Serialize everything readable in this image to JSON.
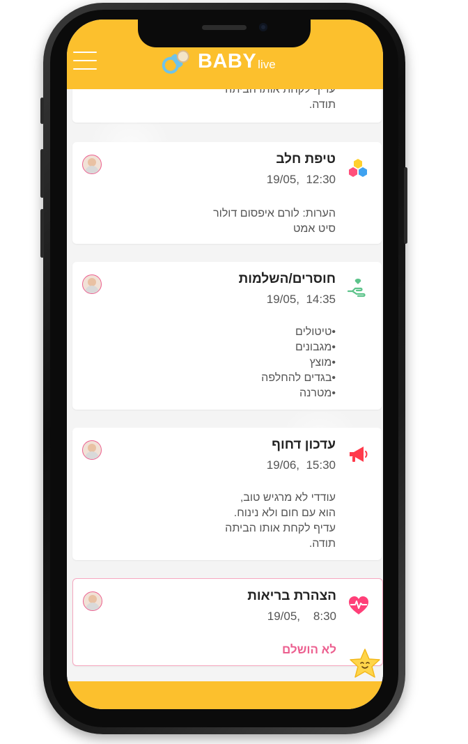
{
  "app": {
    "brand": "BABY",
    "brand_suffix": "live",
    "header_color": "#fcc02d",
    "accent_color": "#ec5f8f"
  },
  "partial_card": {
    "lines": [
      "עדיף לקחת אותו הביתה",
      "תודה."
    ]
  },
  "cards": [
    {
      "icon": "hexagons-icon",
      "title": "טיפת חלב",
      "date": "19/05,",
      "time": "12:30",
      "body": [
        "הערות: לורם איפסום דולור",
        "סיט אמט"
      ]
    },
    {
      "icon": "hand-care-icon",
      "title": "חוסרים/השלמות",
      "date": "19/05,",
      "time": "14:35",
      "body": [
        "•טיטולים",
        "•מגבונים",
        "•מוצץ",
        "•בגדים להחלפה",
        "•מטרנה"
      ]
    },
    {
      "icon": "megaphone-icon",
      "title": "עדכון דחוף",
      "date": "19/06,",
      "time": "15:30",
      "body": [
        "עודדי לא מרגיש טוב,",
        "הוא עם חום ולא נינוח.",
        "עדיף לקחת אותו הביתה",
        "תודה."
      ]
    },
    {
      "icon": "heart-pulse-icon",
      "title": "הצהרת בריאות",
      "date": "19/05,",
      "time": "8:30",
      "status": "לא הושלם"
    }
  ]
}
